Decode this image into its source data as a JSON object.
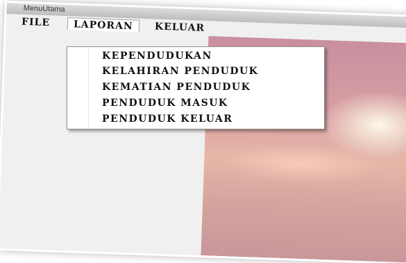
{
  "window": {
    "title": "MenuUtama"
  },
  "menubar": {
    "items": [
      {
        "label": "FILE"
      },
      {
        "label": "LAPORAN"
      },
      {
        "label": "KELUAR"
      }
    ]
  },
  "laporan_menu": {
    "items": [
      {
        "label": "KEPENDUDUKAN"
      },
      {
        "label": "KELAHIRAN PENDUDUK"
      },
      {
        "label": "KEMATIAN PENDUDUK"
      },
      {
        "label": "PENDUDUK MASUK"
      },
      {
        "label": "PENDUDUK KELUAR"
      }
    ]
  }
}
